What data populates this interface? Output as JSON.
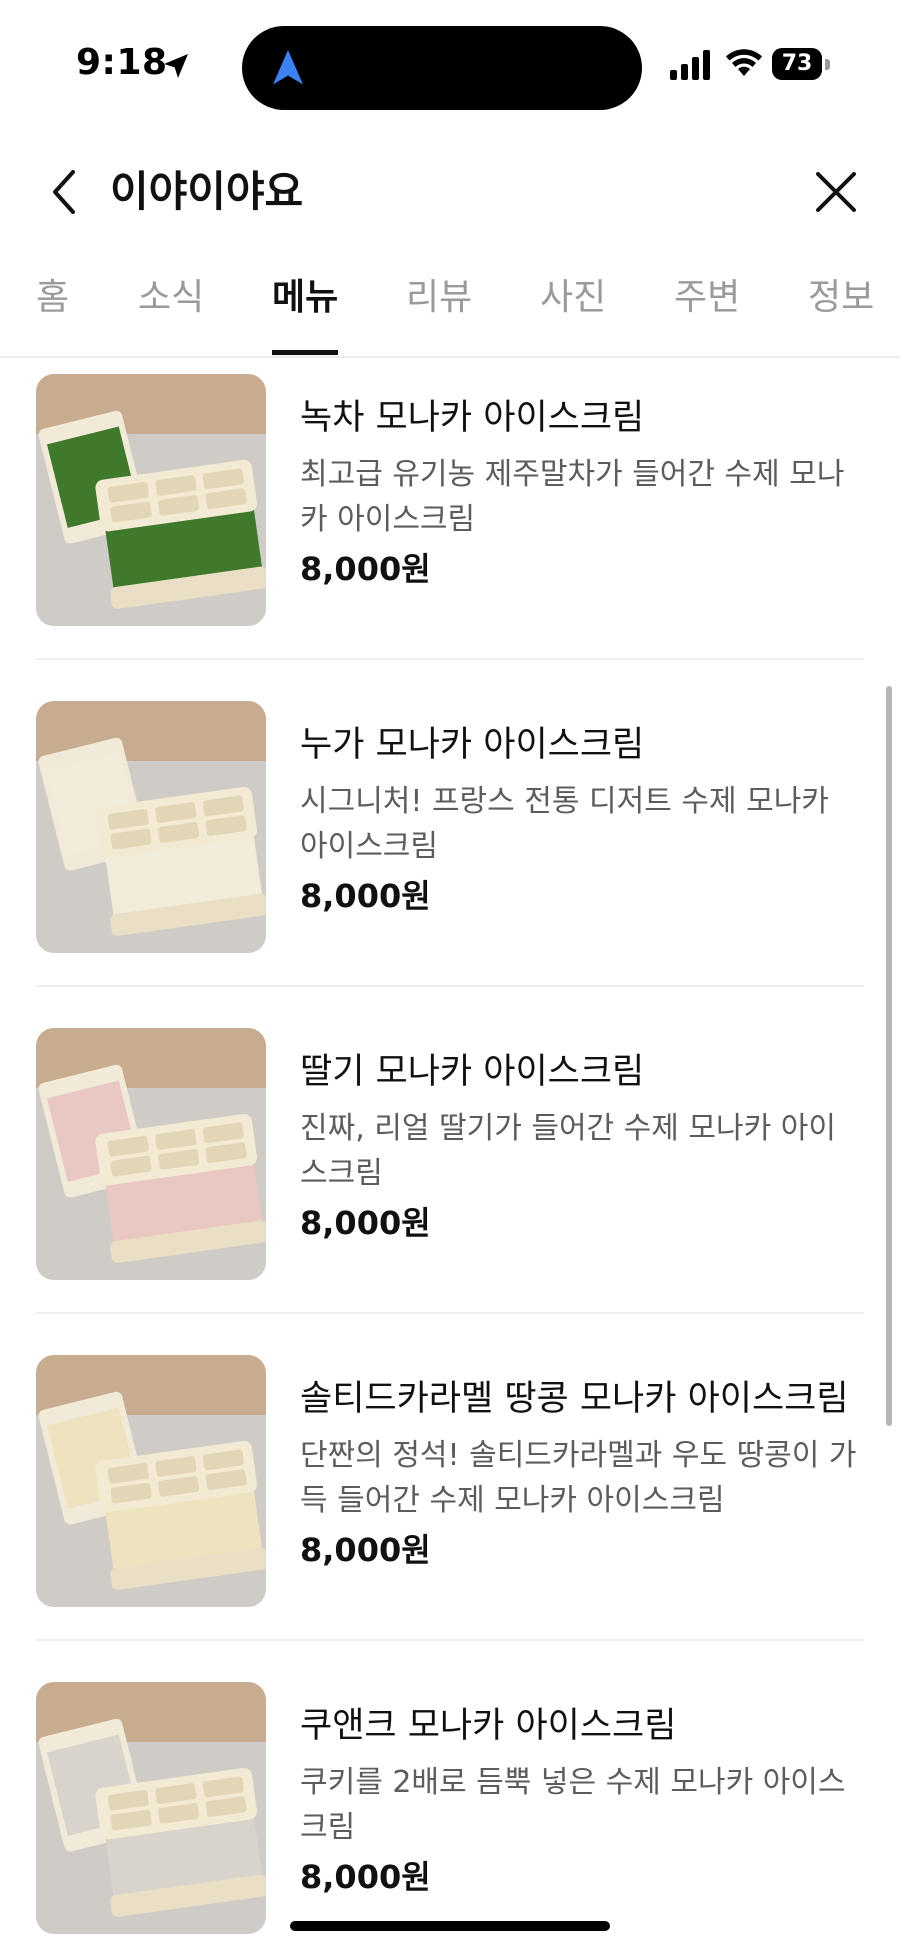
{
  "status_bar": {
    "time": "9:18",
    "battery": "73"
  },
  "header": {
    "title": "이야이야요"
  },
  "tabs": [
    {
      "label": "홈"
    },
    {
      "label": "소식"
    },
    {
      "label": "메뉴",
      "active": true
    },
    {
      "label": "리뷰"
    },
    {
      "label": "사진"
    },
    {
      "label": "주변"
    },
    {
      "label": "정보"
    }
  ],
  "menu": {
    "items": [
      {
        "name": "녹차 모나카 아이스크림",
        "description": "최고급 유기농 제주말차가 들어간 수제 모나카 아이스크림",
        "price": "8,000원",
        "filling_color": "#3f7a2c"
      },
      {
        "name": "누가 모나카 아이스크림",
        "description": "시그니처! 프랑스 전통 디저트 수제 모나카 아이스크림",
        "price": "8,000원",
        "filling_color": "#f1ecda"
      },
      {
        "name": "딸기 모나카 아이스크림",
        "description": "진짜, 리얼 딸기가 들어간 수제 모나카 아이스크림",
        "price": "8,000원",
        "filling_color": "#e9c8c3"
      },
      {
        "name": "솔티드카라멜 땅콩 모나카 아이스크림",
        "description": "단짠의 정석! 솔티드카라멜과 우도 땅콩이 가득 들어간 수제 모나카 아이스크림",
        "price": "8,000원",
        "filling_color": "#efe2bf"
      },
      {
        "name": "쿠앤크 모나카 아이스크림",
        "description": "쿠키를 2배로 듬뿍 넣은 수제 모나카 아이스크림",
        "price": "8,000원",
        "filling_color": "#d8d4cc"
      }
    ]
  }
}
